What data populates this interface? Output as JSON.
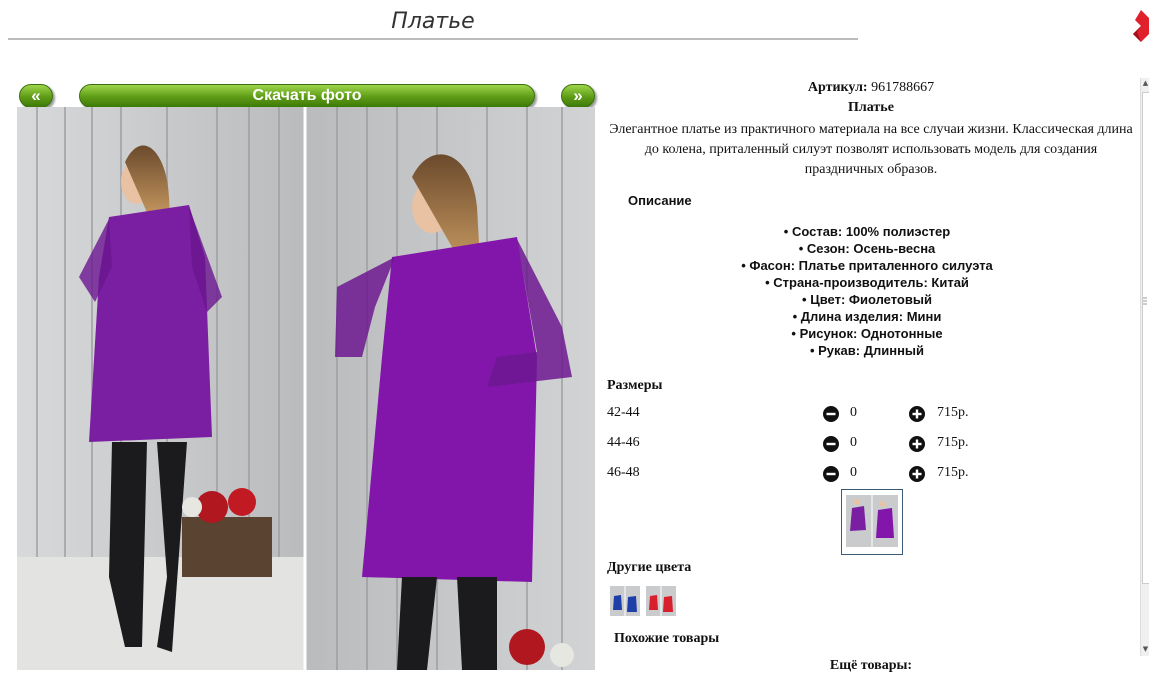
{
  "page": {
    "title": "Платье"
  },
  "gallery": {
    "prev_label": "«",
    "next_label": "»",
    "download_label": "Скачать фото"
  },
  "product": {
    "article_label": "Артикул:",
    "article_value": "961788667",
    "name": "Платье",
    "intro": "Элегантное платье из практичного материала на все случаи жизни. Классическая длина до колена, приталенный силуэт позволят использовать модель для создания праздничных образов.",
    "description_heading": "Описание",
    "features": [
      "Состав: 100% полиэстер",
      "Сезон: Осень-весна",
      "Фасон: Платье приталенного силуэта",
      "Страна-производитель: Китай",
      "Цвет: Фиолетовый",
      "Длина изделия: Мини",
      "Рисунок: Однотонные",
      "Рукав: Длинный"
    ],
    "dress_color": "#7b1fa2"
  },
  "sizes": {
    "heading": "Размеры",
    "rows": [
      {
        "size": "42-44",
        "qty": "0",
        "price": "715р."
      },
      {
        "size": "44-46",
        "qty": "0",
        "price": "715р."
      },
      {
        "size": "46-48",
        "qty": "0",
        "price": "715р."
      }
    ]
  },
  "sections": {
    "other_colors": "Другие цвета",
    "similar": "Похожие товары",
    "more": "Ещё товары:"
  },
  "colors": {
    "accent_green": "#5e9b16",
    "logo_red": "#e0202a",
    "other_color_blue": "#1f3fa8",
    "other_color_red": "#d81f2c"
  }
}
